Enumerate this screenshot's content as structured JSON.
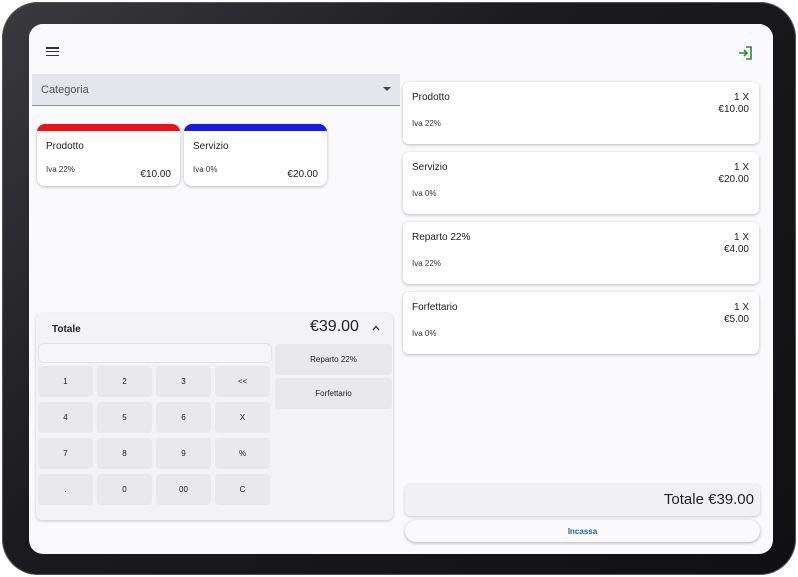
{
  "colors": {
    "accent": "#1f5fae",
    "logout": "#2e8b2e",
    "prodotto_bar": "#e8141a",
    "servizio_bar": "#1a1ae0"
  },
  "header": {
    "menu_icon": "hamburger-menu-icon",
    "logout_icon": "logout-icon"
  },
  "category": {
    "label": "Categoria"
  },
  "products": [
    {
      "name": "Prodotto",
      "iva": "Iva 22%",
      "price": "€10.00",
      "color": "#e8141a"
    },
    {
      "name": "Servizio",
      "iva": "Iva 0%",
      "price": "€20.00",
      "color": "#1a1ae0"
    }
  ],
  "totals": {
    "label": "Totale",
    "value": "€39.00"
  },
  "keypad": [
    "1",
    "2",
    "3",
    "<<",
    "4",
    "5",
    "6",
    "X",
    "7",
    "8",
    "9",
    "%",
    ".",
    "0",
    "00",
    "C"
  ],
  "departments": [
    "Reparto 22%",
    "Forfettario"
  ],
  "receipt": [
    {
      "name": "Prodotto",
      "qty": "1 X",
      "price": "€10.00",
      "iva": "Iva 22%"
    },
    {
      "name": "Servizio",
      "qty": "1 X",
      "price": "€20.00",
      "iva": "Iva 0%"
    },
    {
      "name": "Reparto 22%",
      "qty": "1 X",
      "price": "€4.00",
      "iva": "Iva 22%"
    },
    {
      "name": "Forfettario",
      "qty": "1 X",
      "price": "€5.00",
      "iva": "Iva 0%"
    }
  ],
  "grand_total": "Totale €39.00",
  "pay_button": "Incassa"
}
